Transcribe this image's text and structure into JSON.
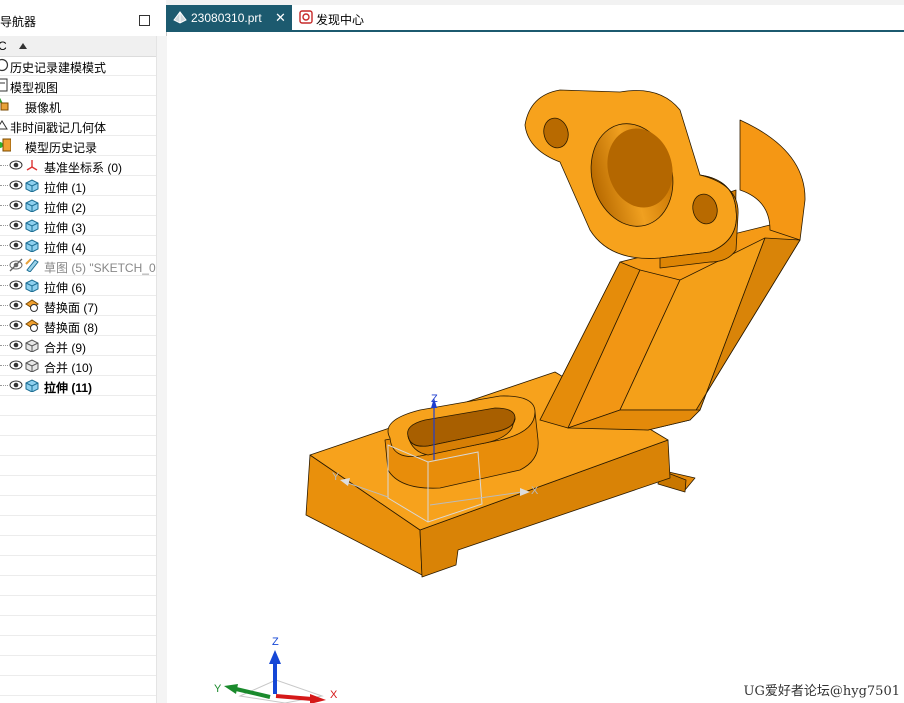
{
  "navigator": {
    "title": "导航器",
    "column_header": "C",
    "items": [
      {
        "label": "历史记录建模模式",
        "icon": "history-mode-icon"
      },
      {
        "label": "模型视图",
        "icon": "model-view-icon"
      },
      {
        "label": "摄像机",
        "icon": "camera-icon"
      },
      {
        "label": "非时间戳记几何体",
        "icon": "non-timestamp-icon"
      },
      {
        "label": "模型历史记录",
        "icon": "model-history-icon"
      },
      {
        "label": "基准坐标系 (0)",
        "icon": "datum-csys-icon",
        "state": "normal"
      },
      {
        "label": "拉伸 (1)",
        "icon": "extrude-icon",
        "state": "normal"
      },
      {
        "label": "拉伸 (2)",
        "icon": "extrude-icon",
        "state": "normal"
      },
      {
        "label": "拉伸 (3)",
        "icon": "extrude-icon",
        "state": "normal"
      },
      {
        "label": "拉伸 (4)",
        "icon": "extrude-icon",
        "state": "normal"
      },
      {
        "label": "草图 (5) \"SKETCH_0",
        "icon": "sketch-icon",
        "state": "hidden"
      },
      {
        "label": "拉伸 (6)",
        "icon": "extrude-icon",
        "state": "normal"
      },
      {
        "label": "替换面 (7)",
        "icon": "replace-face-icon",
        "state": "normal"
      },
      {
        "label": "替换面 (8)",
        "icon": "replace-face-icon",
        "state": "normal"
      },
      {
        "label": "合并 (9)",
        "icon": "unite-icon",
        "state": "normal"
      },
      {
        "label": "合并 (10)",
        "icon": "unite-icon",
        "state": "normal"
      },
      {
        "label": "拉伸 (11)",
        "icon": "extrude-icon",
        "state": "current"
      }
    ]
  },
  "tabs": [
    {
      "label": "23080310.prt",
      "icon": "part-file-icon",
      "active": true
    },
    {
      "label": "发现中心",
      "icon": "discovery-center-icon",
      "active": false
    }
  ],
  "viewport": {
    "model_color": "#F5950E",
    "wcs_axes": {
      "x": "X",
      "y": "Y",
      "z": "Z"
    },
    "triad_axes": {
      "x": "X",
      "y": "Y",
      "z": "Z"
    },
    "watermark": "UG爱好者论坛@hyg7501"
  }
}
